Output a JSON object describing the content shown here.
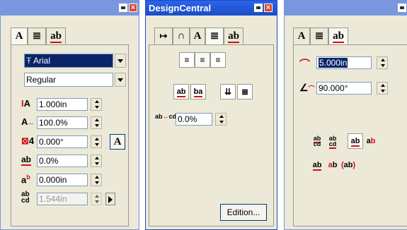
{
  "panel1": {
    "tabs": [
      "A",
      "≣",
      "ab"
    ],
    "font_name": "Arial",
    "font_style": "Regular",
    "height": "1.000in",
    "width_scale": "100.0%",
    "slant": "0.000°",
    "char_spacing": "0.0%",
    "baseline": "0.000in",
    "line_spacing": "1.544in",
    "font_btn": "A"
  },
  "panel2": {
    "title": "DesignCentral",
    "tabs": [
      "↦",
      "∩",
      "A",
      "≣",
      "ab"
    ],
    "spacing": "0.0%",
    "edition_label": "Edition..."
  },
  "panel3": {
    "tabs": [
      "A",
      "≣",
      "ab"
    ],
    "arc_radius": "5.000in",
    "arc_angle": "90.000°"
  },
  "colors": {
    "titlebar": "#2d64e6",
    "inactive_titlebar": "#7a96df",
    "panel_bg": "#ece9d8",
    "selection": "#0a246a"
  }
}
